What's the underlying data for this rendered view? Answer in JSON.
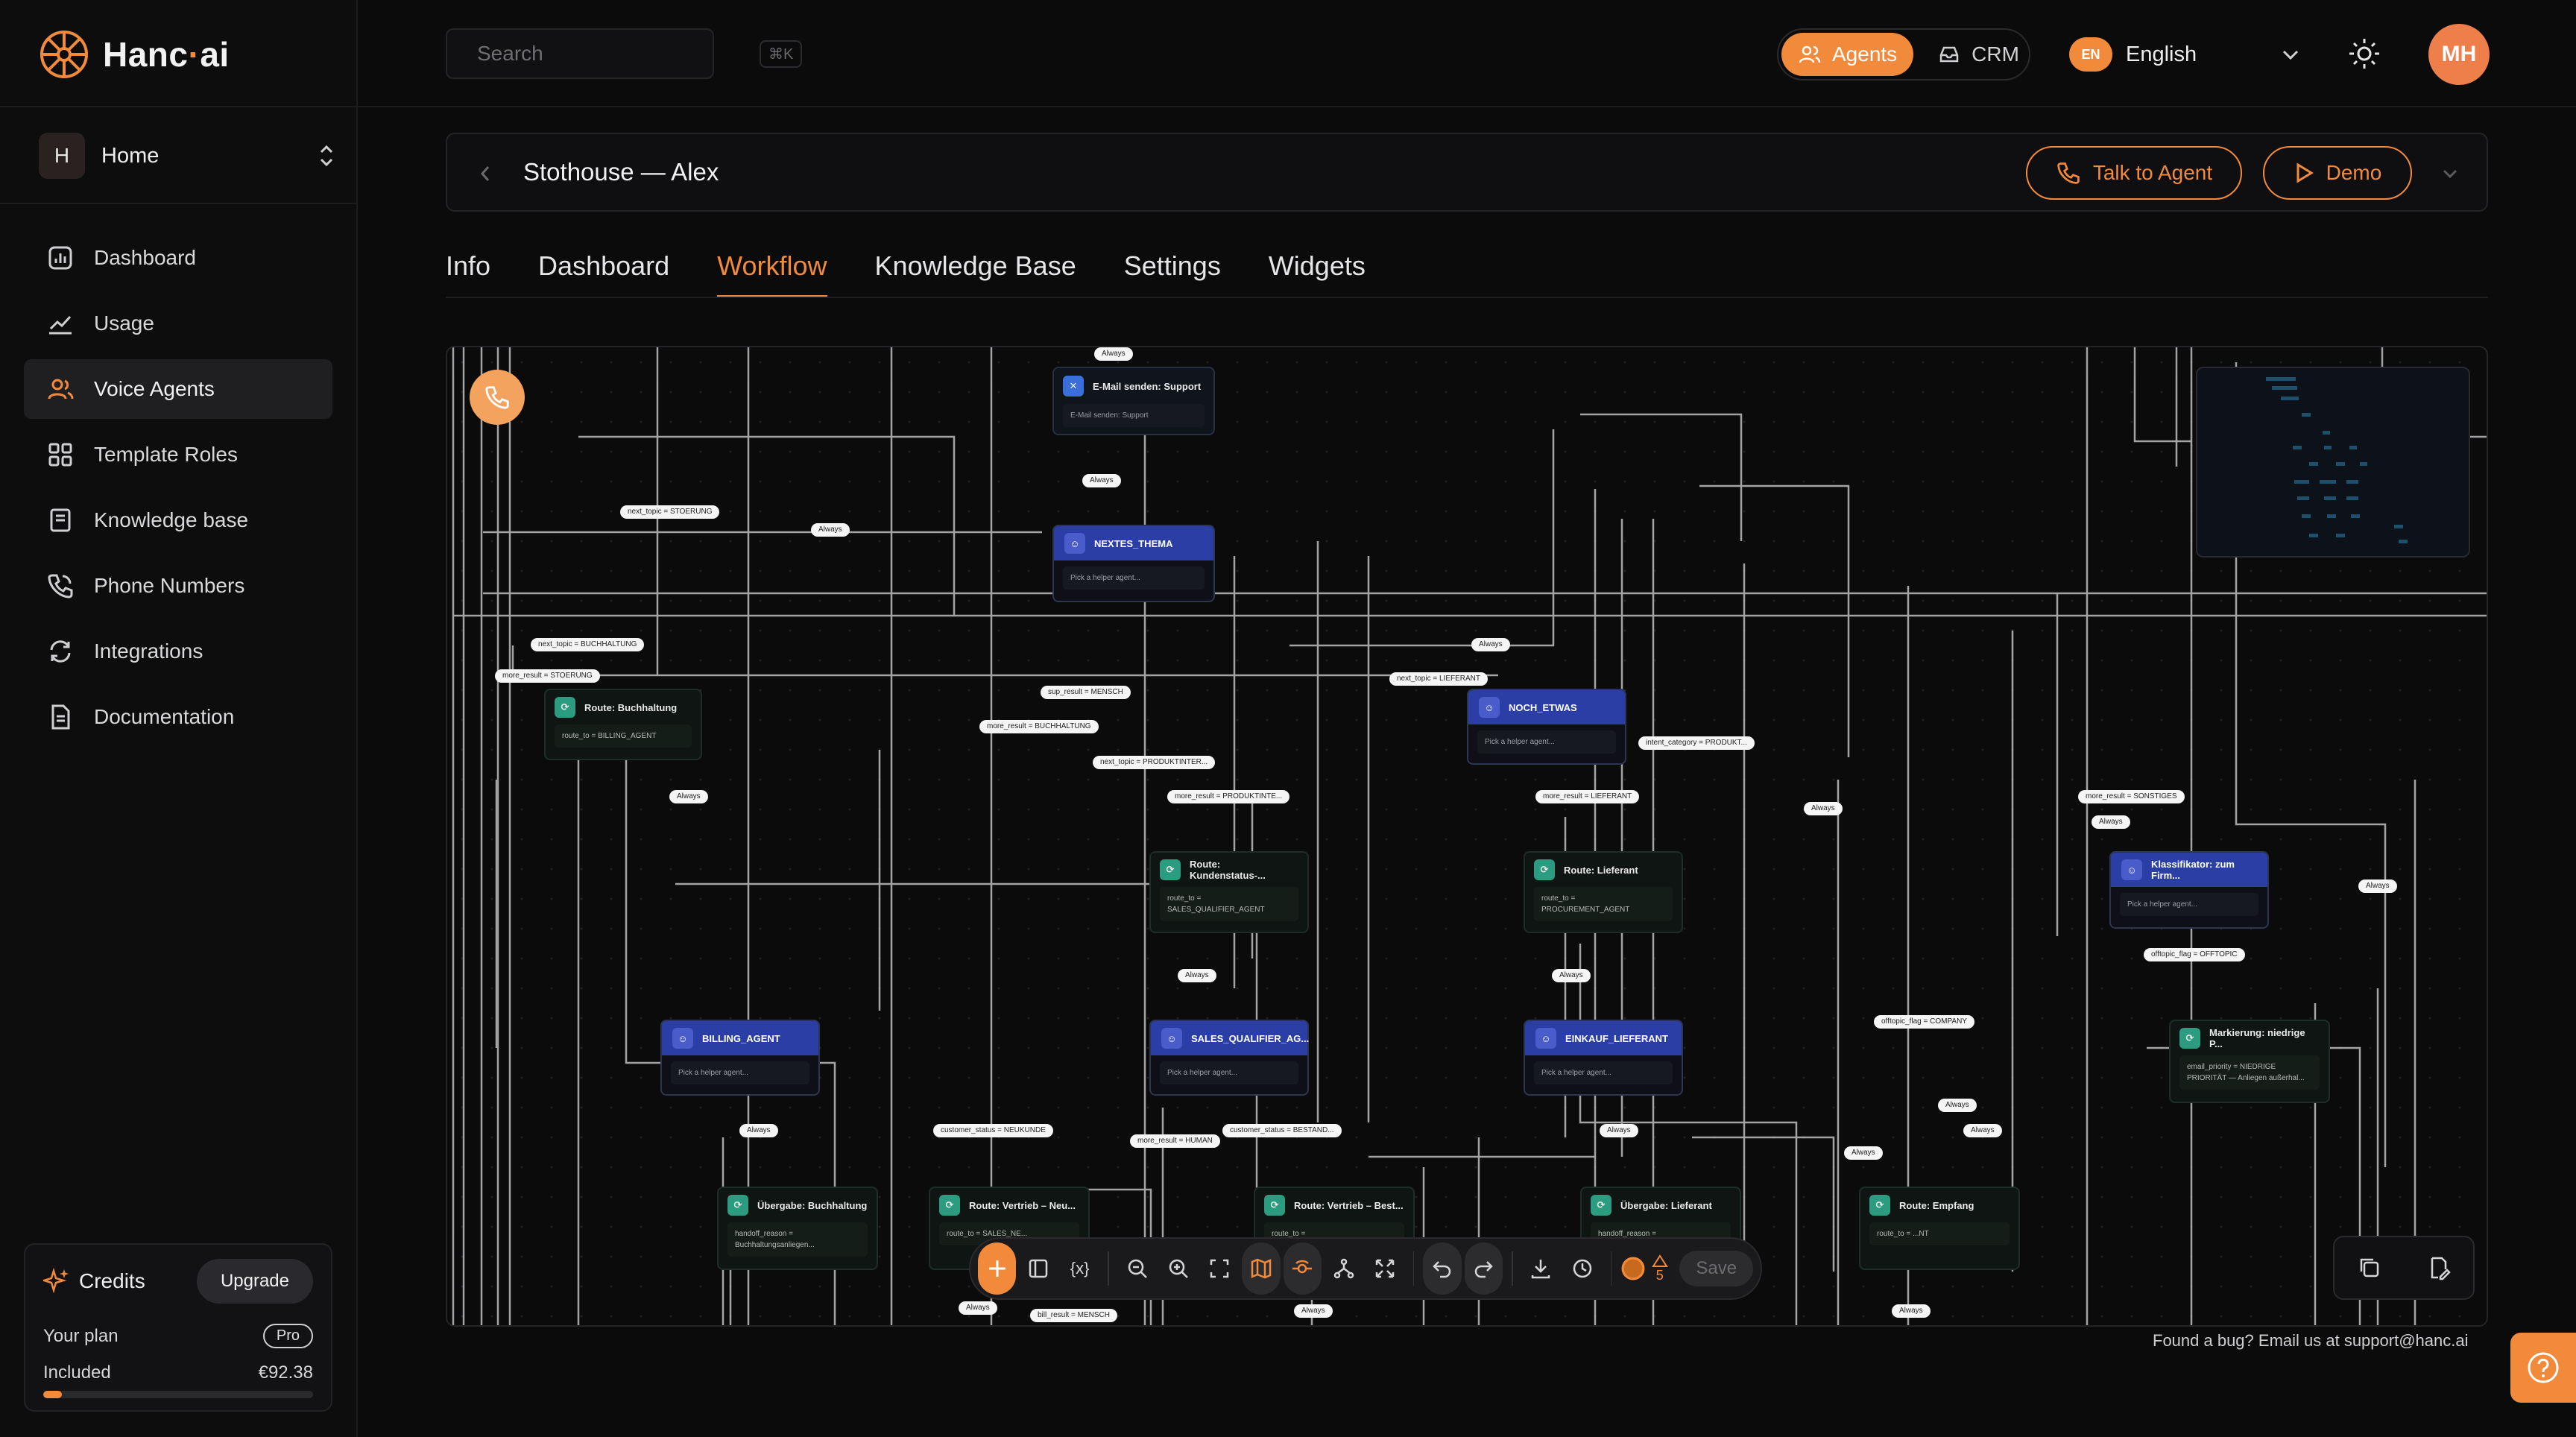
{
  "app": {
    "brand_name": "Hanc",
    "brand_dot": "·",
    "brand_suffix": "ai"
  },
  "workspace": {
    "initial": "H",
    "name": "Home"
  },
  "sidebar": {
    "items": [
      {
        "label": "Dashboard",
        "icon": "dashboard-icon"
      },
      {
        "label": "Usage",
        "icon": "usage-chart-icon"
      },
      {
        "label": "Voice Agents",
        "icon": "users-icon",
        "active": true
      },
      {
        "label": "Template Roles",
        "icon": "grid-icon"
      },
      {
        "label": "Knowledge base",
        "icon": "book-icon"
      },
      {
        "label": "Phone Numbers",
        "icon": "phone-icon"
      },
      {
        "label": "Integrations",
        "icon": "sync-icon"
      },
      {
        "label": "Documentation",
        "icon": "document-icon"
      }
    ]
  },
  "credits": {
    "title": "Credits",
    "upgrade_label": "Upgrade",
    "plan_label": "Your plan",
    "plan_value": "Pro",
    "included_label": "Included",
    "included_value": "€92.38",
    "usage_fraction": 0.07
  },
  "header": {
    "search_placeholder": "Search",
    "search_shortcut": "⌘K",
    "switch": {
      "agents_label": "Agents",
      "crm_label": "CRM"
    },
    "language": {
      "code": "EN",
      "name": "English"
    },
    "avatar_initials": "MH"
  },
  "agent": {
    "title": "Stothouse — Alex",
    "talk_label": "Talk to Agent",
    "demo_label": "Demo"
  },
  "tabs": [
    {
      "label": "Info"
    },
    {
      "label": "Dashboard"
    },
    {
      "label": "Workflow",
      "active": true
    },
    {
      "label": "Knowledge Base"
    },
    {
      "label": "Settings"
    },
    {
      "label": "Widgets"
    }
  ],
  "workflow": {
    "nodes": {
      "email": {
        "title": "E-Mail senden: Support",
        "body": "E-Mail senden: Support"
      },
      "nextes": {
        "title": "NEXTES_THEMA",
        "body": "Pick a helper agent..."
      },
      "noch": {
        "title": "NOCH_ETWAS",
        "body": "Pick a helper agent..."
      },
      "route_buch": {
        "title": "Route: Buchhaltung",
        "body": "route_to = BILLING_AGENT"
      },
      "route_kunden": {
        "title": "Route: Kundenstatus-...",
        "body": "route_to = SALES_QUALIFIER_AGENT"
      },
      "route_lief": {
        "title": "Route: Lieferant",
        "body": "route_to = PROCUREMENT_AGENT"
      },
      "klass": {
        "title": "Klassifikator: zum Firm...",
        "body": "Pick a helper agent..."
      },
      "billing": {
        "title": "BILLING_AGENT",
        "body": "Pick a helper agent..."
      },
      "sales": {
        "title": "SALES_QUALIFIER_AG...",
        "body": "Pick a helper agent..."
      },
      "einkauf": {
        "title": "EINKAUF_LIEFERANT",
        "body": "Pick a helper agent..."
      },
      "markierung": {
        "title": "Markierung: niedrige P...",
        "body": "email_priority = NIEDRIGE PRIORITÄT — Anliegen außerhal..."
      },
      "ueb_buch": {
        "title": "Übergabe: Buchhaltung",
        "body": "handoff_reason = Buchhaltungsanliegen..."
      },
      "route_neu": {
        "title": "Route: Vertrieb – Neu...",
        "body": "route_to = SALES_NE..."
      },
      "route_best": {
        "title": "Route: Vertrieb – Best...",
        "body": "route_to ="
      },
      "ueb_lief": {
        "title": "Übergabe: Lieferant",
        "body": "handoff_reason ="
      },
      "route_empf": {
        "title": "Route: Empfang",
        "body": "route_to = ...NT"
      }
    },
    "edge_labels": {
      "always": "Always",
      "next_stoerung": "next_topic = STOERUNG",
      "next_buch": "next_topic = BUCHHALTUNG",
      "more_stoerung": "more_result = STOERUNG",
      "sup_mensch": "sup_result = MENSCH",
      "next_lief": "next_topic = LIEFERANT",
      "more_buch": "more_result = BUCHHALTUNG",
      "next_prod": "next_topic = PRODUKTINTER...",
      "intent_prod": "intent_category = PRODUKT...",
      "more_prod": "more_result = PRODUKTINTE...",
      "more_lief": "more_result = LIEFERANT",
      "more_sonst": "more_result = SONSTIGES",
      "offtopic": "offtopic_flag = OFFTOPIC",
      "offtopic_company": "offtopic_flag = COMPANY",
      "cust_neu": "customer_status = NEUKUNDE",
      "more_human": "more_result = HUMAN",
      "cust_best": "customer_status = BESTAND...",
      "bill_mensch": "bill_result = MENSCH"
    },
    "toolbar": {
      "warning_count": "5",
      "save_label": "Save",
      "variables_label": "{x}"
    }
  },
  "footer": {
    "bug_note": "Found a bug? Email us at support@hanc.ai"
  },
  "colors": {
    "accent": "#f28a3c",
    "agent_node": "#2a3ea6",
    "route_icon": "#2b9c80"
  }
}
